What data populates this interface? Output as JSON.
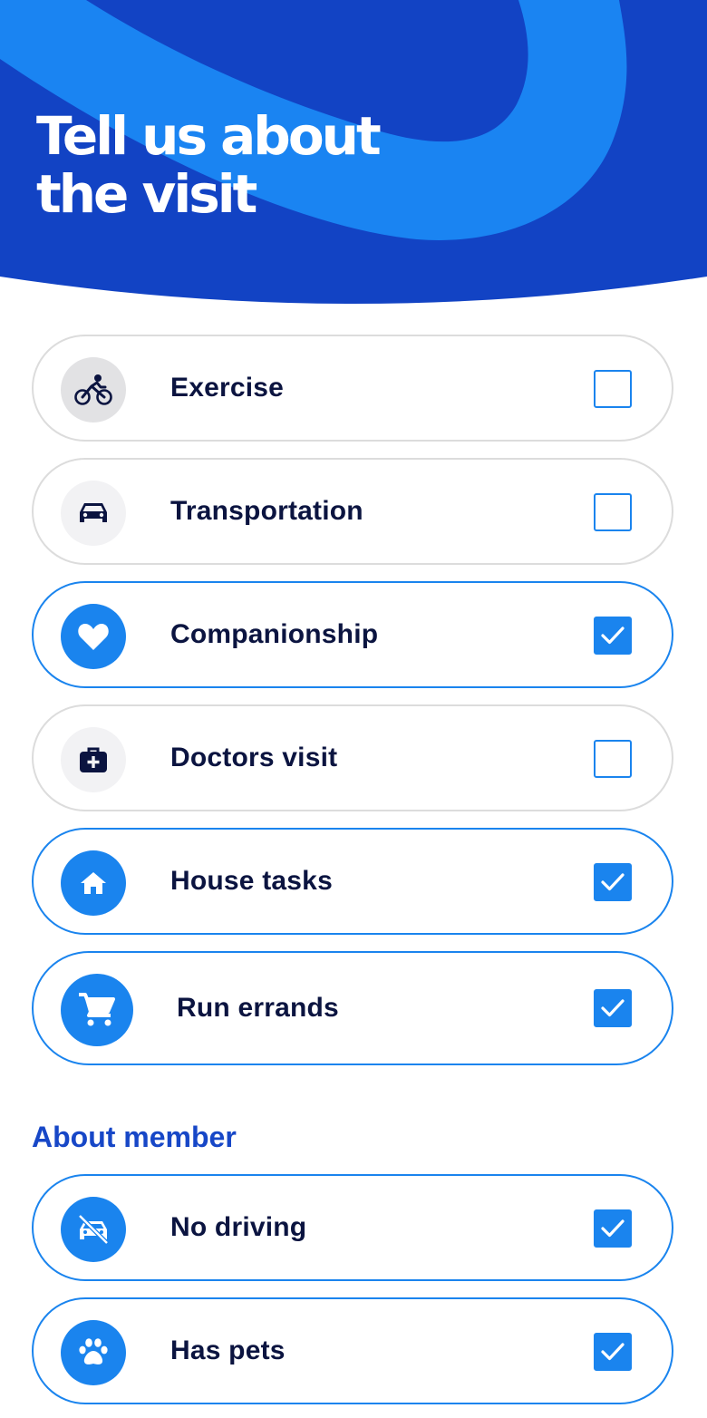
{
  "header": {
    "title": "Tell us about\nthe visit",
    "colors": {
      "background": "#1243c4",
      "swoosh": "#1a84f2"
    }
  },
  "visit_options": [
    {
      "label": "Exercise",
      "icon": "bicycle-icon",
      "checked": false
    },
    {
      "label": "Transportation",
      "icon": "car-icon",
      "checked": false
    },
    {
      "label": "Companionship",
      "icon": "heart-icon",
      "checked": true
    },
    {
      "label": "Doctors visit",
      "icon": "medical-bag-icon",
      "checked": false
    },
    {
      "label": "House tasks",
      "icon": "home-icon",
      "checked": true
    },
    {
      "label": "Run errands",
      "icon": "shopping-cart-icon",
      "checked": true
    }
  ],
  "about_member": {
    "title": "About member",
    "options": [
      {
        "label": "No driving",
        "icon": "no-driving-icon",
        "checked": true
      },
      {
        "label": "Has pets",
        "icon": "paw-icon",
        "checked": true
      }
    ]
  },
  "colors": {
    "accent": "#1a84ee",
    "text_dark": "#0b1440",
    "section_title": "#1747c7",
    "card_border": "#dcdcdc"
  }
}
